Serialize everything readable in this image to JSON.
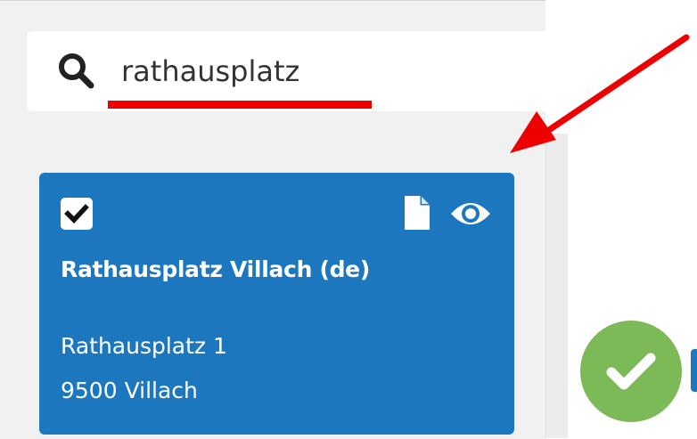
{
  "search": {
    "value": "rathausplatz",
    "icon": "search-icon"
  },
  "result": {
    "checked": true,
    "title": "Rathausplatz Villach (de)",
    "address_line1": "Rathausplatz 1",
    "address_line2": "9500 Villach",
    "icons": [
      "checkbox-checked-icon",
      "document-icon",
      "eye-icon"
    ]
  },
  "confirm": {
    "icon": "checkmark-icon"
  },
  "annotation": {
    "arrow": "red-arrow-icon",
    "underline": "red-underline"
  },
  "colors": {
    "card": "#1c77bf",
    "confirm": "#7cba57",
    "annotation": "#ee0000",
    "panel": "#f1f1f1"
  }
}
